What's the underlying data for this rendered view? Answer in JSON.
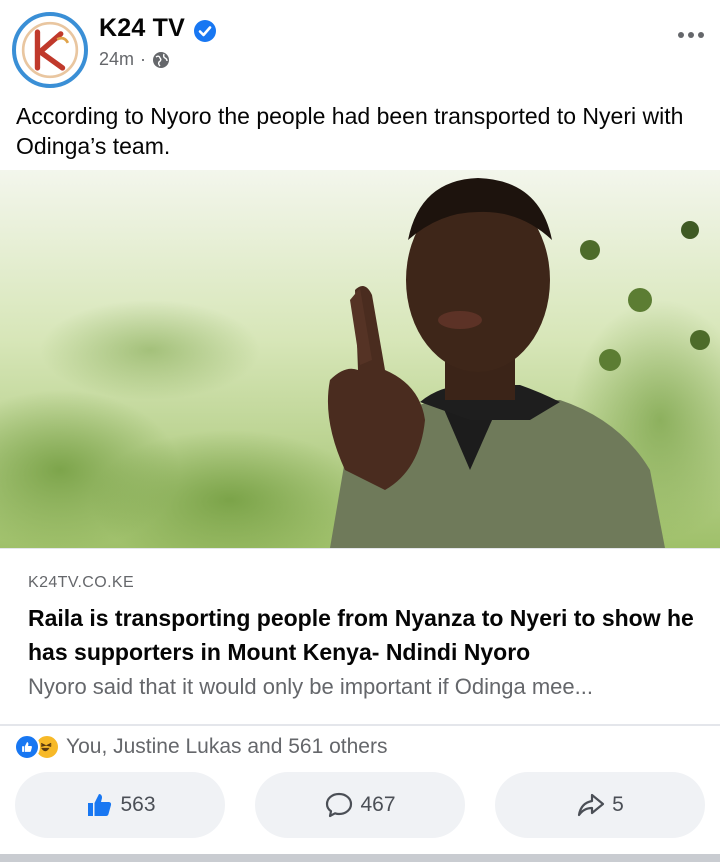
{
  "post": {
    "page_name": "K24 TV",
    "time": "24m",
    "separator": "·",
    "caption": "According to Nyoro the people had been transported to Nyeri with Odinga’s team."
  },
  "link_preview": {
    "domain": "K24TV.CO.KE",
    "headline": "Raila is transporting people from Nyanza to Nyeri to show he has supporters in Mount Kenya- Ndindi Nyoro",
    "description": "Nyoro said that it would only be important if Odinga mee..."
  },
  "reactions": {
    "summary": "You, Justine Lukas and 561 others",
    "icons": [
      "like-icon",
      "haha-icon"
    ]
  },
  "actions": {
    "like_count": "563",
    "comment_count": "467",
    "share_count": "5"
  },
  "colors": {
    "accent": "#1877f2",
    "logo_ring": "#3a8fd6",
    "muted_text": "#65676b",
    "button_bg": "#f0f2f5"
  }
}
